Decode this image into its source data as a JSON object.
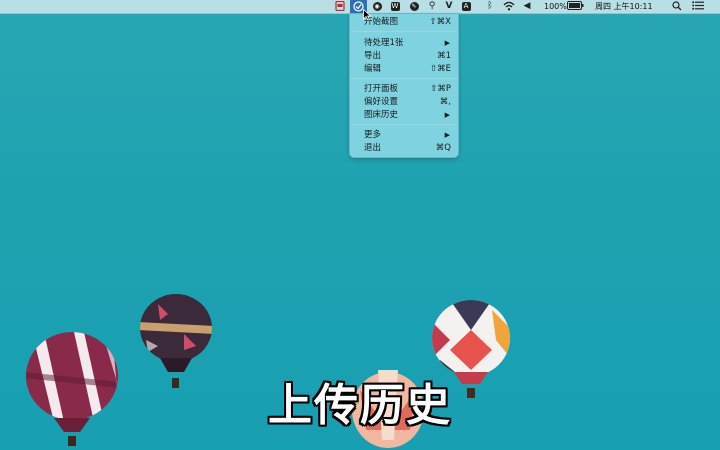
{
  "menubar": {
    "battery": "100%",
    "datetime": "周四 上午10:11",
    "icons": [
      "pdf-app-icon",
      "screenshot-app-icon",
      "circle-app-icon",
      "w-app-icon",
      "pen-app-icon",
      "search-app-icon",
      "v-app-icon",
      "a-app-icon",
      "bluetooth-icon",
      "wifi-icon",
      "volume-icon",
      "battery-icon",
      "spotlight-icon",
      "control-list-icon"
    ]
  },
  "menu": {
    "items": [
      {
        "label": "开始截图",
        "shortcut": "⇧⌘X"
      },
      {
        "label": "待处理1张",
        "arrow": "▶"
      },
      {
        "label": "导出",
        "shortcut": "⌘1"
      },
      {
        "label": "编辑",
        "shortcut": "⇧⌘E"
      },
      {
        "label": "打开面板",
        "shortcut": "⇧⌘P"
      },
      {
        "label": "偏好设置",
        "shortcut": "⌘,"
      },
      {
        "label": "图床历史",
        "arrow": "▶"
      },
      {
        "label": "更多",
        "arrow": "▶"
      },
      {
        "label": "退出",
        "shortcut": "⌘Q"
      }
    ]
  },
  "caption": "上传历史",
  "colors": {
    "desktop": "#1fa3b3",
    "menu": "#7fd3e0",
    "accent": "#2e6fb8"
  }
}
